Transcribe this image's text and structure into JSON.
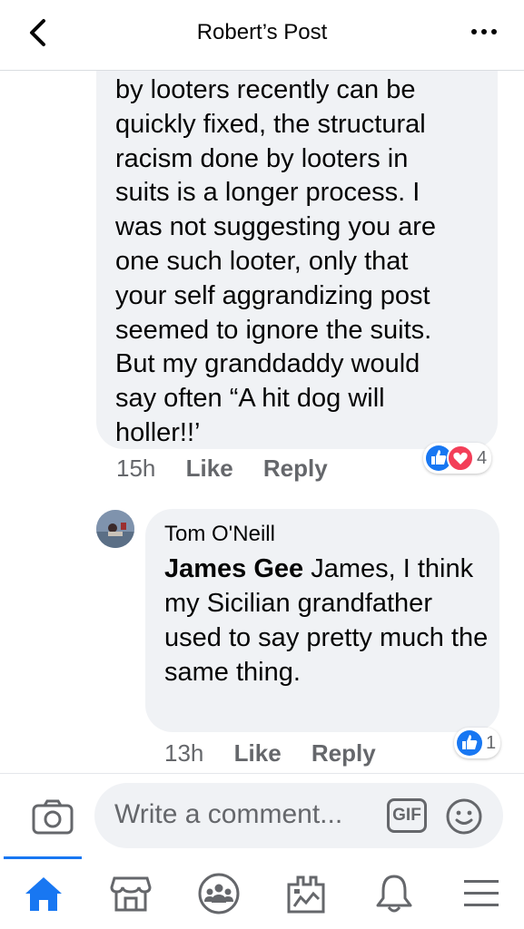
{
  "header": {
    "title": "Robert’s Post",
    "back_icon": "chevron-left-icon",
    "more_icon": "more-dots-icon"
  },
  "comment1": {
    "text": "by looters recently can be\nquickly fixed, the structural\nracism done by looters in\nsuits is a longer process. I\nwas not suggesting you are\none such looter, only that\nyour self aggrandizing post\nseemed to ignore the suits.\nBut my granddaddy would\nsay often “A hit dog will\nholler!!’",
    "time": "15h",
    "like_label": "Like",
    "reply_label": "Reply",
    "reaction_count": "4"
  },
  "comment2": {
    "author": "Tom O'Neill",
    "mention": "James Gee",
    "text": " James, I think my Sicilian grandfather used to say pretty much the same thing.",
    "time": "13h",
    "like_label": "Like",
    "reply_label": "Reply",
    "reaction_count": "1"
  },
  "composer": {
    "placeholder": "Write a comment...",
    "gif_label": "GIF"
  },
  "tabs": [
    "home-icon",
    "marketplace-icon",
    "groups-icon",
    "pages-icon",
    "notifications-icon",
    "menu-icon"
  ],
  "colors": {
    "accent": "#1877f2",
    "bubble": "#f0f2f5",
    "love": "#f33e58",
    "secondary_text": "#65676b"
  }
}
